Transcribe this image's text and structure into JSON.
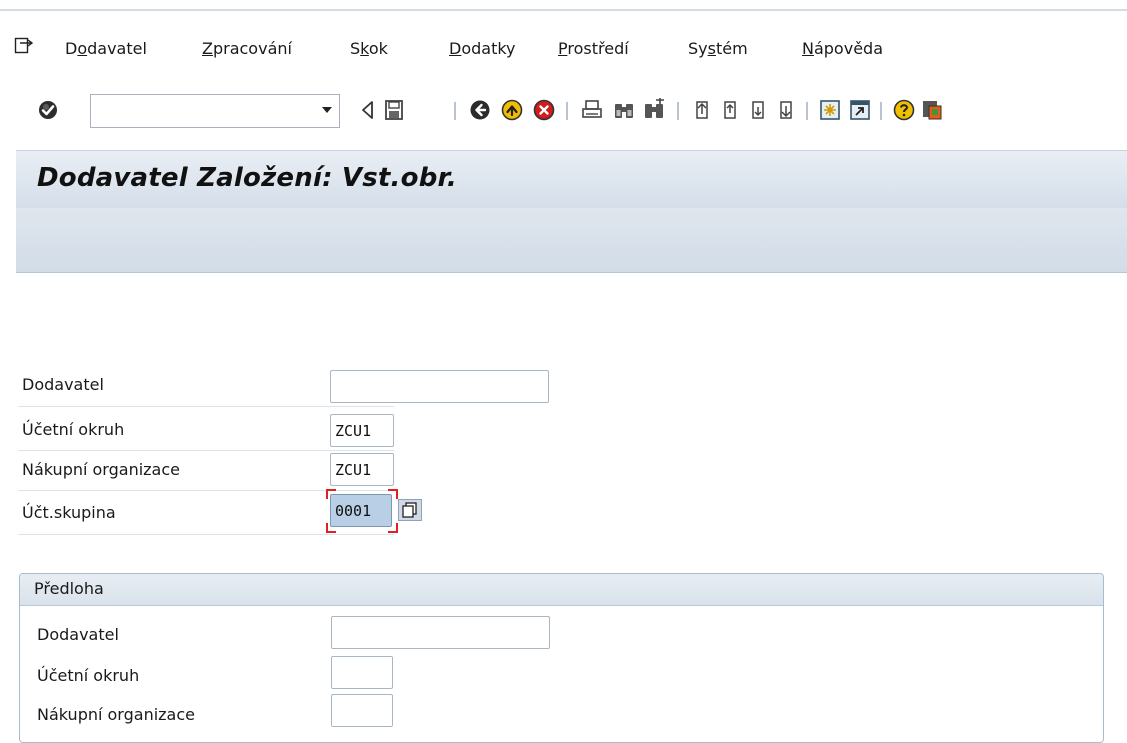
{
  "menu": {
    "items": [
      {
        "pre": "D",
        "u": "o",
        "post": "davatel"
      },
      {
        "pre": "",
        "u": "Z",
        "post": "pracování"
      },
      {
        "pre": "S",
        "u": "k",
        "post": "ok"
      },
      {
        "pre": "",
        "u": "D",
        "post": "odatky"
      },
      {
        "pre": "",
        "u": "P",
        "post": "rostředí"
      },
      {
        "pre": "Sy",
        "u": "s",
        "post": "tém"
      },
      {
        "pre": "",
        "u": "N",
        "post": "ápověda"
      }
    ]
  },
  "toolbar": {
    "command_value": "",
    "icons": [
      "enter-icon",
      "back-arrow-icon",
      "save-icon",
      "back-icon",
      "exit-icon",
      "cancel-icon",
      "print-icon",
      "find-icon",
      "find-next-icon",
      "first-page-icon",
      "previous-page-icon",
      "next-page-icon",
      "last-page-icon",
      "create-session-icon",
      "shortcut-icon",
      "help-icon",
      "customize-layout-icon"
    ]
  },
  "title": "Dodavatel Založení: Vst.obr.",
  "form": {
    "vendor_label": "Dodavatel",
    "vendor_value": "",
    "company_code_label": "Účetní okruh",
    "company_code_value": "ZCU1",
    "purch_org_label": "Nákupní organizace",
    "purch_org_value": "ZCU1",
    "account_group_label": "Účt.skupina",
    "account_group_value": "0001"
  },
  "reference": {
    "title": "Předloha",
    "vendor_label": "Dodavatel",
    "vendor_value": "",
    "company_code_label": "Účetní okruh",
    "company_code_value": "",
    "purch_org_label": "Nákupní organizace",
    "purch_org_value": ""
  },
  "colors": {
    "title_bar": "#d4dee9",
    "highlight_field": "#b8cfe6",
    "focus": "#dd2222",
    "separator": "#b8c4d0"
  }
}
